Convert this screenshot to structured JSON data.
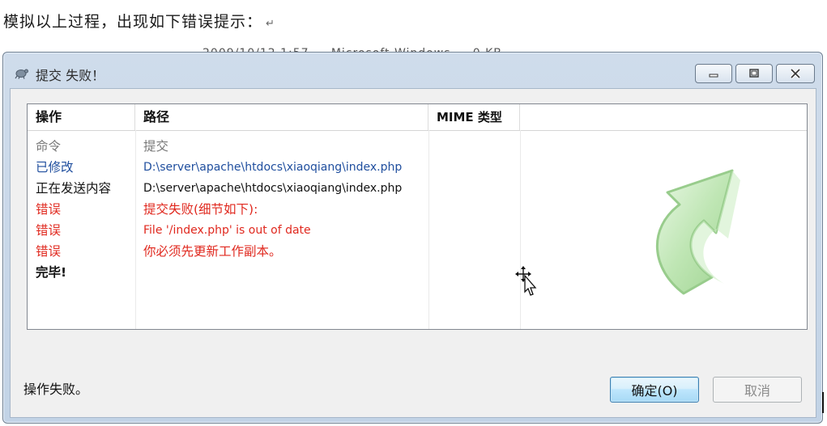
{
  "document": {
    "line": "模拟以上过程，出现如下错误提示：",
    "return_mark": "↵",
    "partial_text": "2009/10/12 1:57 ... Microsoft Windows ... 0 KB"
  },
  "window": {
    "title": "提交 失败！",
    "controls": [
      "minimize",
      "maximize",
      "close"
    ]
  },
  "list": {
    "columns": [
      "操作",
      "路径",
      "MIME 类型"
    ],
    "rows": [
      {
        "op": "命令",
        "path": "提交",
        "color": "#777777"
      },
      {
        "op": "已修改",
        "path": "D:\\server\\apache\\htdocs\\xiaoqiang\\index.php",
        "color": "#1f4e9e"
      },
      {
        "op": "正在发送内容",
        "path": "D:\\server\\apache\\htdocs\\xiaoqiang\\index.php",
        "color": "#111111"
      },
      {
        "op": "错误",
        "path": "提交失败(细节如下):",
        "color": "#e0281e"
      },
      {
        "op": "错误",
        "path": "File '/index.php' is out of date",
        "color": "#e0281e"
      },
      {
        "op": "错误",
        "path": "你必须先更新工作副本。",
        "color": "#e0281e"
      },
      {
        "op": "完毕!",
        "path": "",
        "color": "#111111"
      }
    ]
  },
  "status": "操作失败。",
  "buttons": {
    "ok": "确定(O)",
    "cancel": "取消"
  }
}
